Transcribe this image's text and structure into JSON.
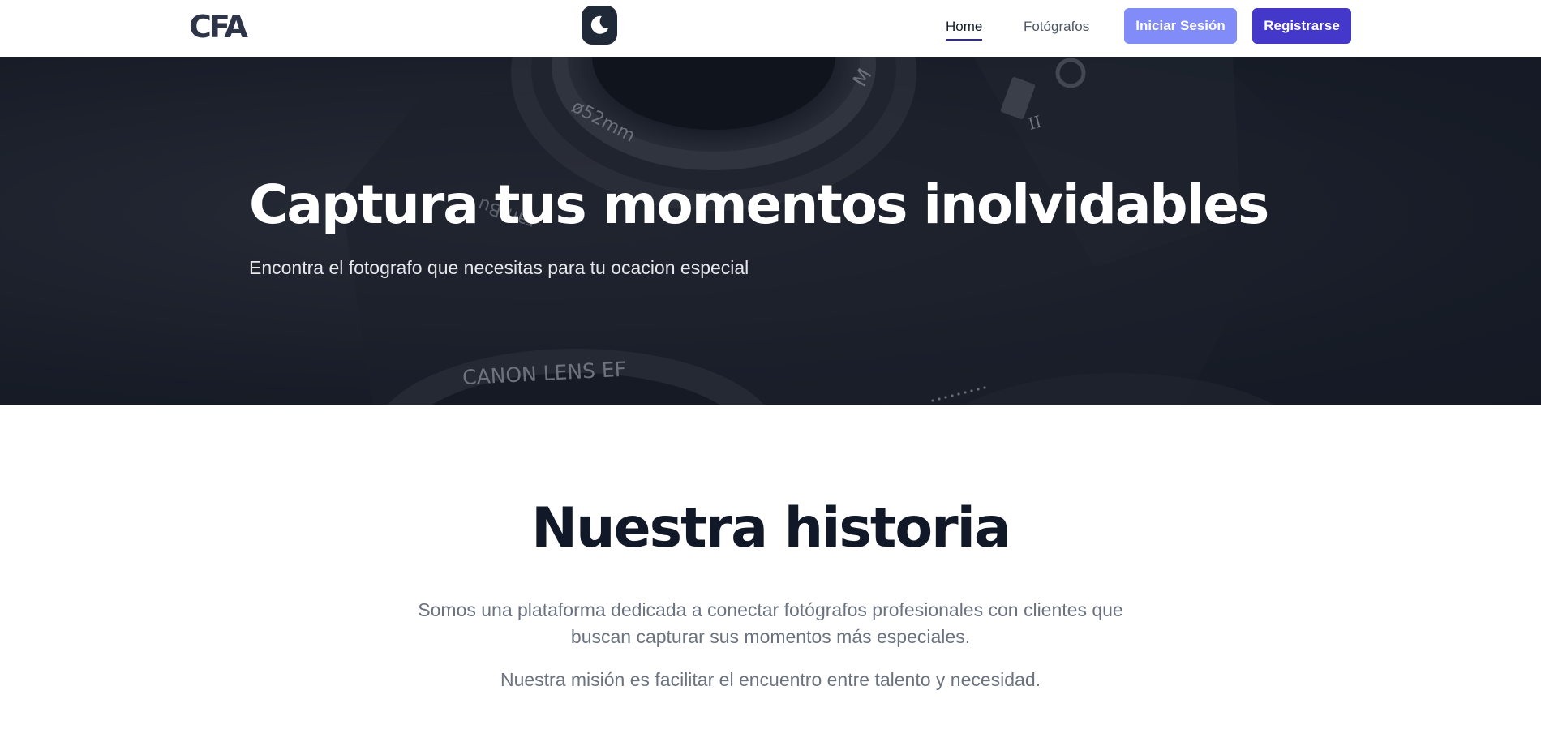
{
  "navbar": {
    "logo_text": "CFA",
    "theme_toggle_icon": "moon-icon",
    "links": [
      {
        "label": "Home",
        "active": true
      },
      {
        "label": "Fotógrafos",
        "active": false
      }
    ],
    "login_label": "Iniciar Sesión",
    "register_label": "Registrarse"
  },
  "hero": {
    "title": "Captura tus momentos inolvidables",
    "subtitle": "Encontra el fotografo que necesitas para tu ocacion especial",
    "background_texts": {
      "lens_size": "ø52mm",
      "mark": "II",
      "brand_partial": "ramBu",
      "lens_label": "CANON  LENS  EF",
      "ring_letter": "M"
    }
  },
  "history": {
    "title": "Nuestra historia",
    "paragraph_1": "Somos una plataforma dedicada a conectar fotógrafos profesionales con clientes que buscan capturar sus momentos más especiales.",
    "paragraph_2": "Nuestra misión es facilitar el encuentro entre talento y necesidad."
  },
  "colors": {
    "primary": "#4338ca",
    "primary_light": "#818cf8",
    "dark": "#1f2937",
    "text_muted": "#6b7280",
    "logo": "#2f3548"
  }
}
